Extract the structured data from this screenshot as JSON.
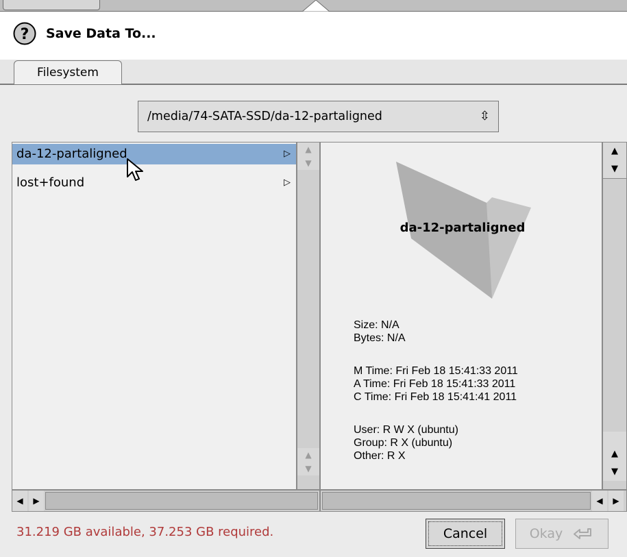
{
  "dialog": {
    "title": "Save Data To..."
  },
  "tabs": [
    {
      "label": "Filesystem"
    }
  ],
  "path": {
    "value": "/media/74-SATA-SSD/da-12-partaligned",
    "arrows": "⇳"
  },
  "files": [
    {
      "name": "da-12-partaligned",
      "selected": true
    },
    {
      "name": "lost+found",
      "selected": false
    }
  ],
  "preview": {
    "name": "da-12-partaligned",
    "size": "Size: N/A",
    "bytes": "Bytes: N/A",
    "mtime": "M Time: Fri Feb 18 15:41:33 2011",
    "atime": "A Time: Fri Feb 18 15:41:33 2011",
    "ctime": "C Time: Fri Feb 18 15:41:41 2011",
    "user": "User: R W X  (ubuntu)",
    "group": "Group: R X  (ubuntu)",
    "other": "Other: R X"
  },
  "status": {
    "text": "31.219 GB available, 37.253 GB required."
  },
  "buttons": {
    "cancel": "Cancel",
    "okay": "Okay"
  },
  "colors": {
    "selection": "#86aad2",
    "status_text": "#b03a3a",
    "panel_bg": "#ebebeb"
  },
  "icons": {
    "help": "question-icon",
    "folder": "folder-icon",
    "row_arrow": "triangle-right-icon",
    "okay": "return-arrow-icon",
    "cursor": "mouse-pointer-icon"
  }
}
